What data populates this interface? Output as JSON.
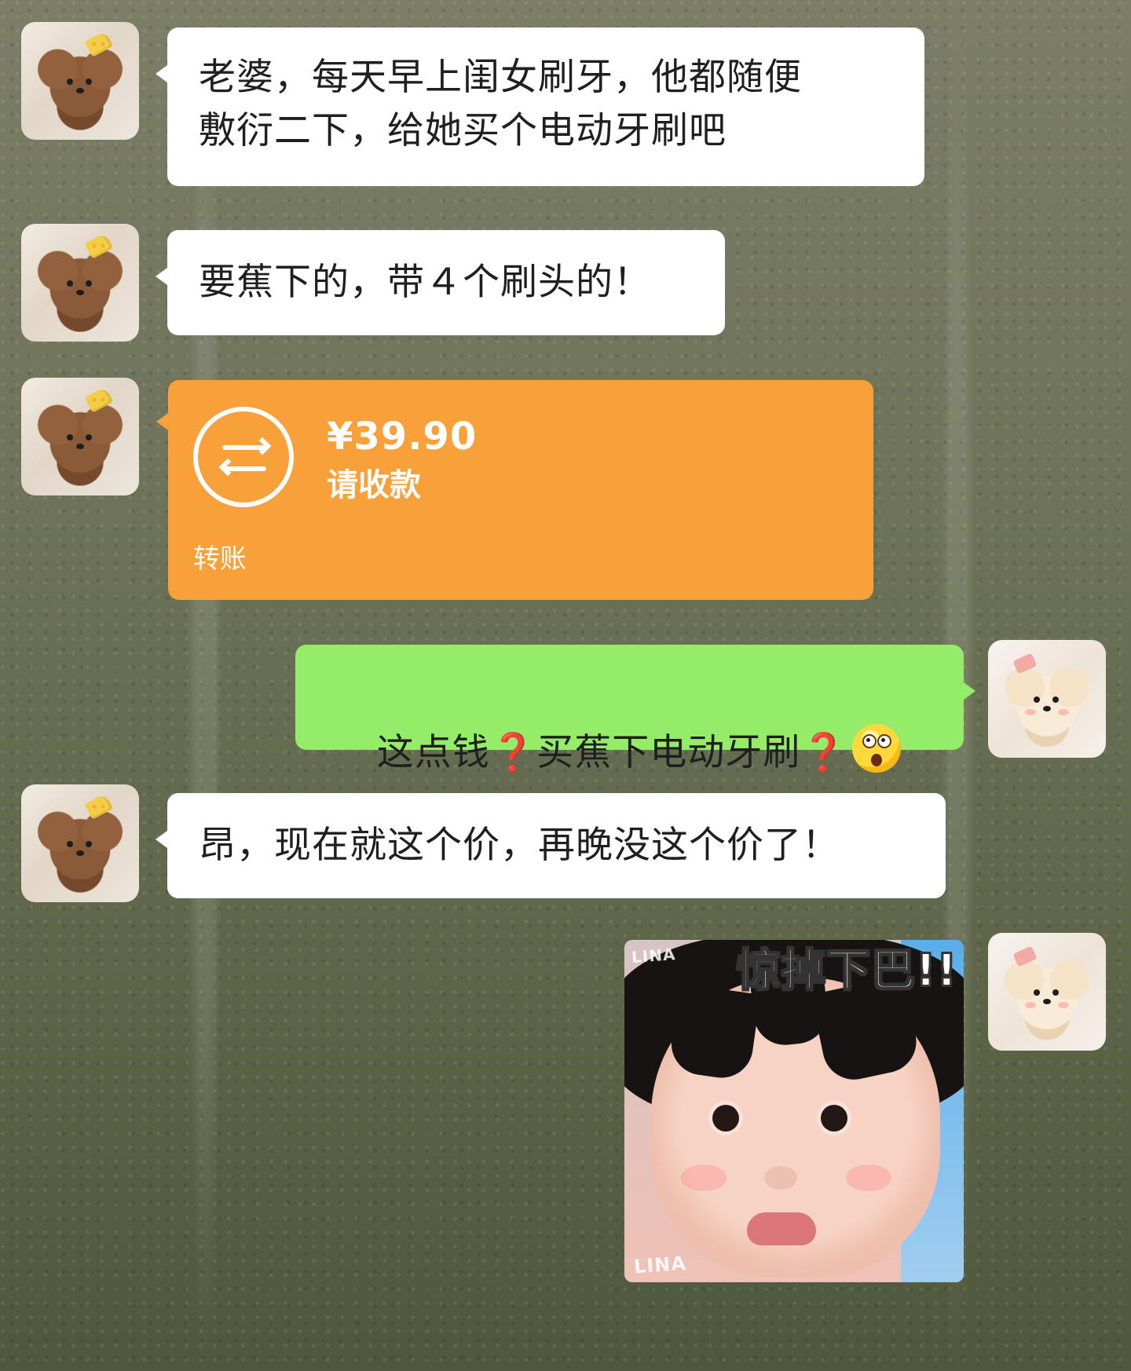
{
  "messages": [
    {
      "text": "老婆，每天早上闺女刷牙，他都随便\n敷衍二下，给她买个电动牙刷吧"
    },
    {
      "text": "要蕉下的，带４个刷头的！"
    },
    {
      "transfer": {
        "amount": "¥39.90",
        "status": "请收款",
        "type": "转账"
      }
    },
    {
      "parts": {
        "part1": "这点钱",
        "q1": "❓",
        "part2": "买蕉下电动牙刷",
        "q2": "❓"
      },
      "emoji": "surprised-emoji"
    },
    {
      "text": "昂，现在就这个价，再晚没这个价了！"
    },
    {
      "sticker": {
        "caption": "惊掉下巴!!",
        "watermark_top": "LINA",
        "watermark_bottom": "LINA"
      }
    }
  ],
  "colors": {
    "green_bubble": "#95ec69",
    "white_bubble": "#ffffff",
    "transfer_orange": "#f8a03a",
    "question_red": "#d9232d"
  },
  "icons": {
    "transfer": "transfer-arrows-icon",
    "emoji": "surprised-emoji"
  }
}
